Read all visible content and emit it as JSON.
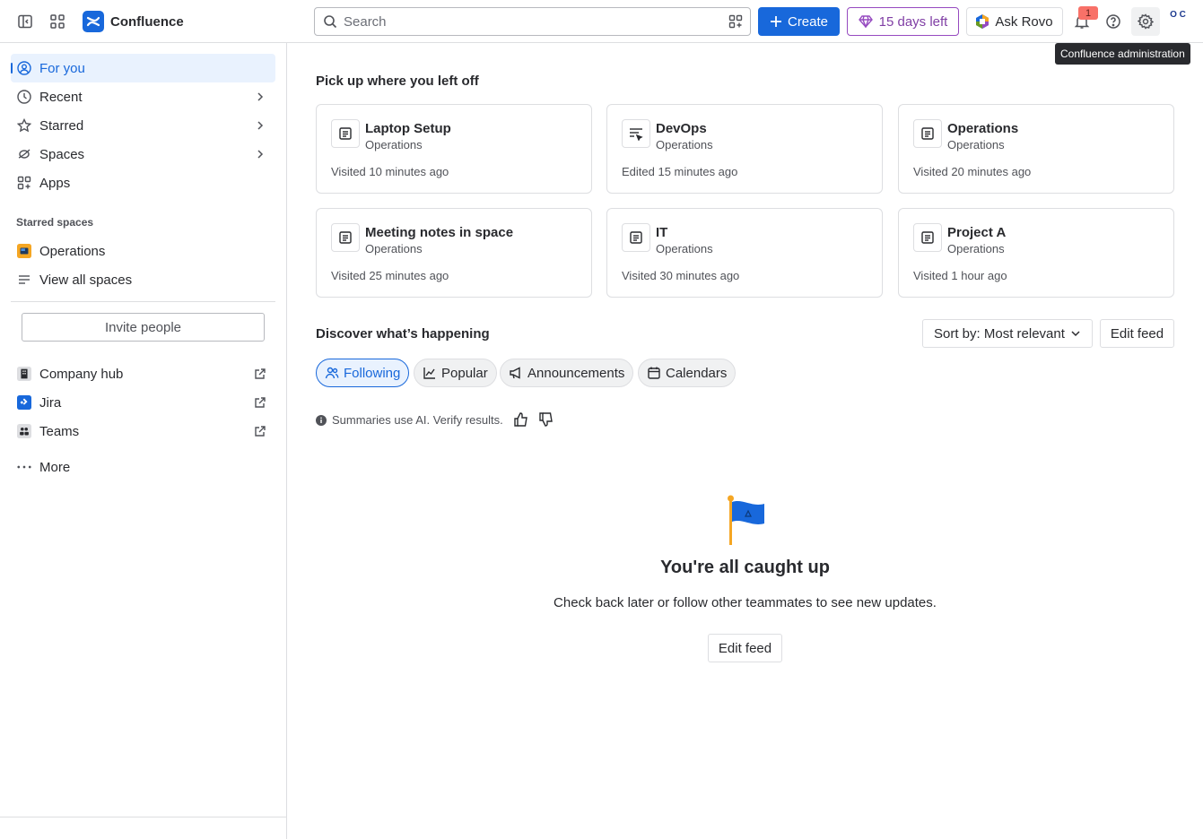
{
  "app": {
    "name": "Confluence"
  },
  "topbar": {
    "search_placeholder": "Search",
    "create_label": "Create",
    "trial_label": "15 days left",
    "rovo_label": "Ask Rovo",
    "notification_count": "1",
    "avatar_initials": "O C",
    "tooltip": "Confluence administration"
  },
  "sidebar": {
    "nav": [
      {
        "label": "For you",
        "icon": "user-circle-icon",
        "active": true
      },
      {
        "label": "Recent",
        "icon": "clock-icon"
      },
      {
        "label": "Starred",
        "icon": "star-icon"
      },
      {
        "label": "Spaces",
        "icon": "spaces-icon"
      },
      {
        "label": "Apps",
        "icon": "apps-icon"
      }
    ],
    "starred_title": "Starred spaces",
    "starred": [
      {
        "label": "Operations",
        "icon": "operations-space-icon"
      },
      {
        "label": "View all spaces",
        "icon": "list-icon"
      }
    ],
    "invite_label": "Invite people",
    "external": [
      {
        "label": "Company hub",
        "icon": "building-icon"
      },
      {
        "label": "Jira",
        "icon": "jira-icon"
      },
      {
        "label": "Teams",
        "icon": "teams-icon"
      }
    ],
    "more_label": "More"
  },
  "main": {
    "pickup_title": "Pick up where you left off",
    "cards": [
      {
        "title": "Laptop Setup",
        "space": "Operations",
        "time": "Visited 10 minutes ago",
        "icon": "page-icon"
      },
      {
        "title": "DevOps",
        "space": "Operations",
        "time": "Edited 15 minutes ago",
        "icon": "list-page-icon"
      },
      {
        "title": "Operations",
        "space": "Operations",
        "time": "Visited 20 minutes ago",
        "icon": "page-icon"
      },
      {
        "title": "Meeting notes in space",
        "space": "Operations",
        "time": "Visited 25 minutes ago",
        "icon": "page-icon"
      },
      {
        "title": "IT",
        "space": "Operations",
        "time": "Visited 30 minutes ago",
        "icon": "page-icon"
      },
      {
        "title": "Project A",
        "space": "Operations",
        "time": "Visited 1 hour ago",
        "icon": "page-icon"
      }
    ],
    "discover_title": "Discover what’s happening",
    "sort_label": "Sort by: Most relevant",
    "edit_feed_label": "Edit feed",
    "tabs": [
      {
        "label": "Following",
        "icon": "people-icon",
        "active": true
      },
      {
        "label": "Popular",
        "icon": "trend-icon"
      },
      {
        "label": "Announcements",
        "icon": "megaphone-icon"
      },
      {
        "label": "Calendars",
        "icon": "calendar-icon"
      }
    ],
    "ai_note": "Summaries use AI. Verify results.",
    "empty_title": "You're all caught up",
    "empty_subtitle": "Check back later or follow other teammates to see new updates.",
    "empty_button": "Edit feed"
  },
  "colors": {
    "brand": "#1868DB",
    "trial": "#964AC0",
    "notification": "#F87168"
  }
}
